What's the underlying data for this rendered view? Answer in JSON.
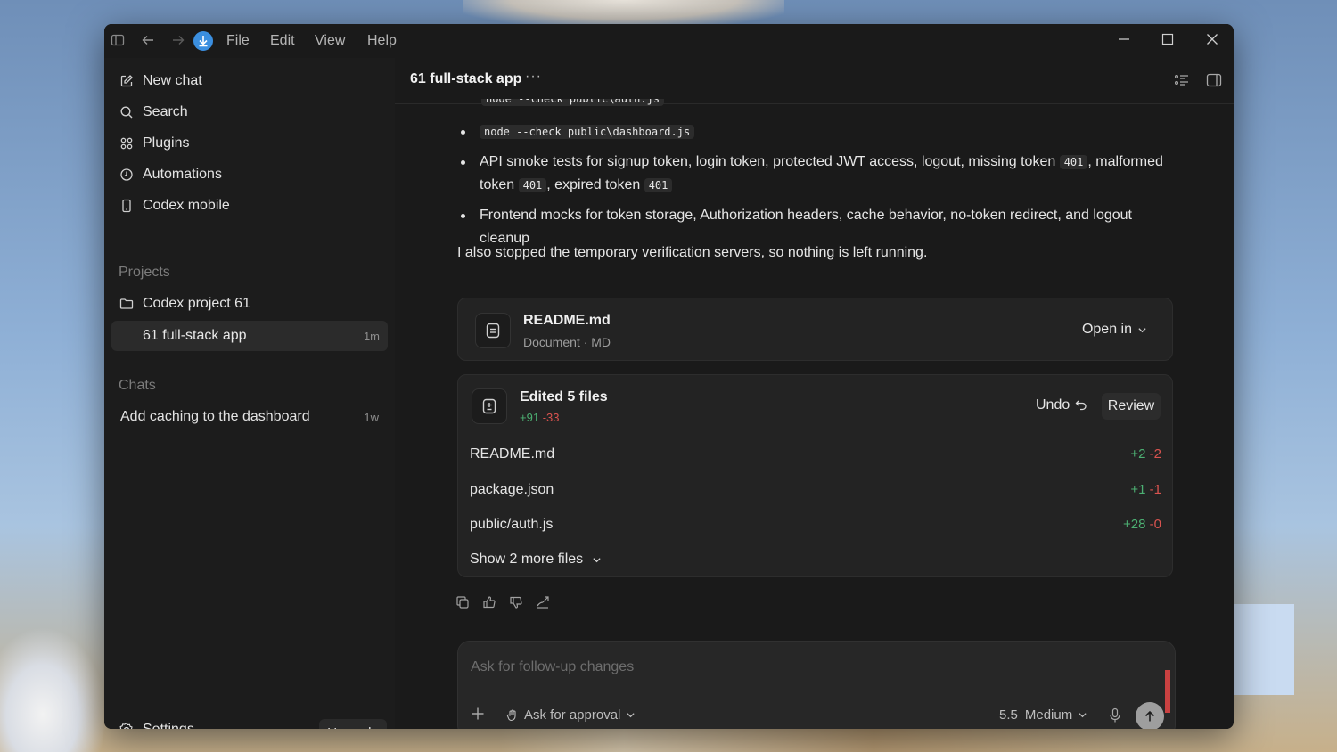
{
  "menu": {
    "file": "File",
    "edit": "Edit",
    "view": "View",
    "help": "Help"
  },
  "sidebar": {
    "nav": [
      {
        "label": "New chat",
        "icon": "edit-icon"
      },
      {
        "label": "Search",
        "icon": "search-icon"
      },
      {
        "label": "Plugins",
        "icon": "grid-icon"
      },
      {
        "label": "Automations",
        "icon": "clock-icon"
      },
      {
        "label": "Codex mobile",
        "icon": "phone-icon"
      }
    ],
    "projects_label": "Projects",
    "project": {
      "name": "Codex project 61",
      "icon": "folder-icon"
    },
    "active_thread": {
      "label": "61 full-stack app",
      "time": "1m"
    },
    "chats_label": "Chats",
    "chats": [
      {
        "label": "Add caching to the dashboard",
        "time": "1w"
      }
    ],
    "settings_label": "Settings",
    "upgrade_label": "Upgrade"
  },
  "header": {
    "title": "61 full-stack app",
    "more": "···"
  },
  "message": {
    "bullet1_code": "node --check public\\dashboard.js",
    "bullet2_text_a": "API smoke tests for signup token, login token, protected JWT access, logout, missing token",
    "bullet2_code_1": "401",
    "bullet2_text_b": ", malformed token",
    "bullet2_code_2": "401",
    "bullet2_text_c": ", expired token",
    "bullet2_code_3": "401",
    "bullet3": "Frontend mocks for token storage, Authorization headers, cache behavior, no-token redirect, and logout cleanup",
    "paragraph": "I also stopped the temporary verification servers, so nothing is left running."
  },
  "readme_card": {
    "title": "README.md",
    "subtitle": "Document · MD",
    "open_in": "Open in"
  },
  "edits_card": {
    "title": "Edited 5 files",
    "added": "+91",
    "removed": "-33",
    "undo": "Undo",
    "review": "Review",
    "files": [
      {
        "name": "README.md",
        "added": "+2",
        "removed": "-2"
      },
      {
        "name": "package.json",
        "added": "+1",
        "removed": "-1"
      },
      {
        "name": "public/auth.js",
        "added": "+28",
        "removed": "-0"
      }
    ],
    "show_more": "Show 2 more files"
  },
  "composer": {
    "placeholder": "Ask for follow-up changes",
    "approval": "Ask for approval",
    "model": "5.5",
    "effort": "Medium"
  },
  "colors": {
    "added": "#4caf72",
    "removed": "#d9534f",
    "accent": "#3b8fe0"
  }
}
